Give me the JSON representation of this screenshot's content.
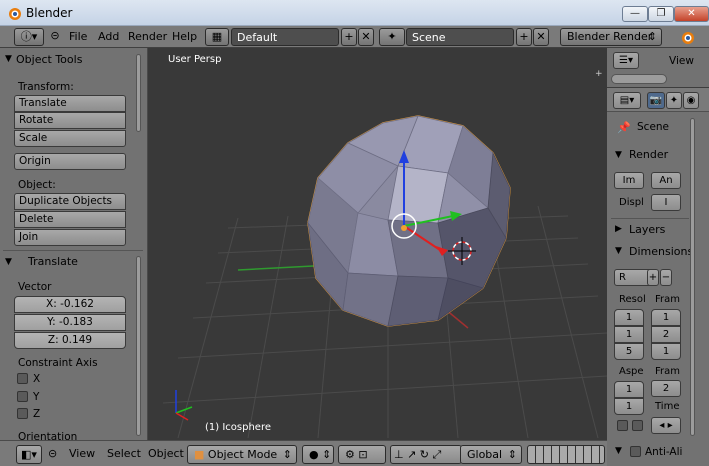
{
  "window": {
    "title": "Blender"
  },
  "infobar": {
    "menus": [
      "File",
      "Add",
      "Render",
      "Help"
    ],
    "screen_layout": "Default",
    "scene": "Scene",
    "render_engine": "Blender Render"
  },
  "toolshelf": {
    "panel_title": "Object Tools",
    "transform_label": "Transform:",
    "transform_buttons": [
      "Translate",
      "Rotate",
      "Scale"
    ],
    "origin_button": "Origin",
    "object_label": "Object:",
    "object_buttons": [
      "Duplicate Objects",
      "Delete",
      "Join"
    ],
    "operator_title": "Translate",
    "vector_label": "Vector",
    "vector": [
      "X: -0.162",
      "Y: -0.183",
      "Z: 0.149"
    ],
    "constraint_label": "Constraint Axis",
    "constraints": [
      "X",
      "Y",
      "Z"
    ],
    "orientation_label": "Orientation"
  },
  "viewport": {
    "view_name": "User Persp",
    "object_info": "(1) Icosphere"
  },
  "outliner": {
    "view_label": "View"
  },
  "properties": {
    "scene_label": "Scene",
    "render_title": "Render",
    "render_btn1": "Im",
    "render_btn2": "An",
    "display_label": "Displ",
    "display_value": "I",
    "layers_title": "Layers",
    "dimensions_title": "Dimensions",
    "preset_value": "R",
    "resolution_label": "Resol",
    "frame_label": "Fram",
    "res_values": [
      "1",
      "1",
      "5"
    ],
    "frame_values": [
      "1",
      "2",
      "1"
    ],
    "aspect_label": "Aspe",
    "frame_rate_label": "Fram",
    "aspect_values": [
      "1",
      "1"
    ],
    "frame_rate_value": "2",
    "time_label": "Time",
    "antialias_label": "Anti-Ali"
  },
  "bottombar": {
    "menus": [
      "View",
      "Select",
      "Object"
    ],
    "mode": "Object Mode",
    "orientation": "Global"
  },
  "colors": {
    "viewport_bg": "#393939",
    "panel_bg": "#727272",
    "selection_outline": "#f0a030",
    "axis_x": "#e02020",
    "axis_y": "#20c020",
    "axis_z": "#2040e0"
  }
}
